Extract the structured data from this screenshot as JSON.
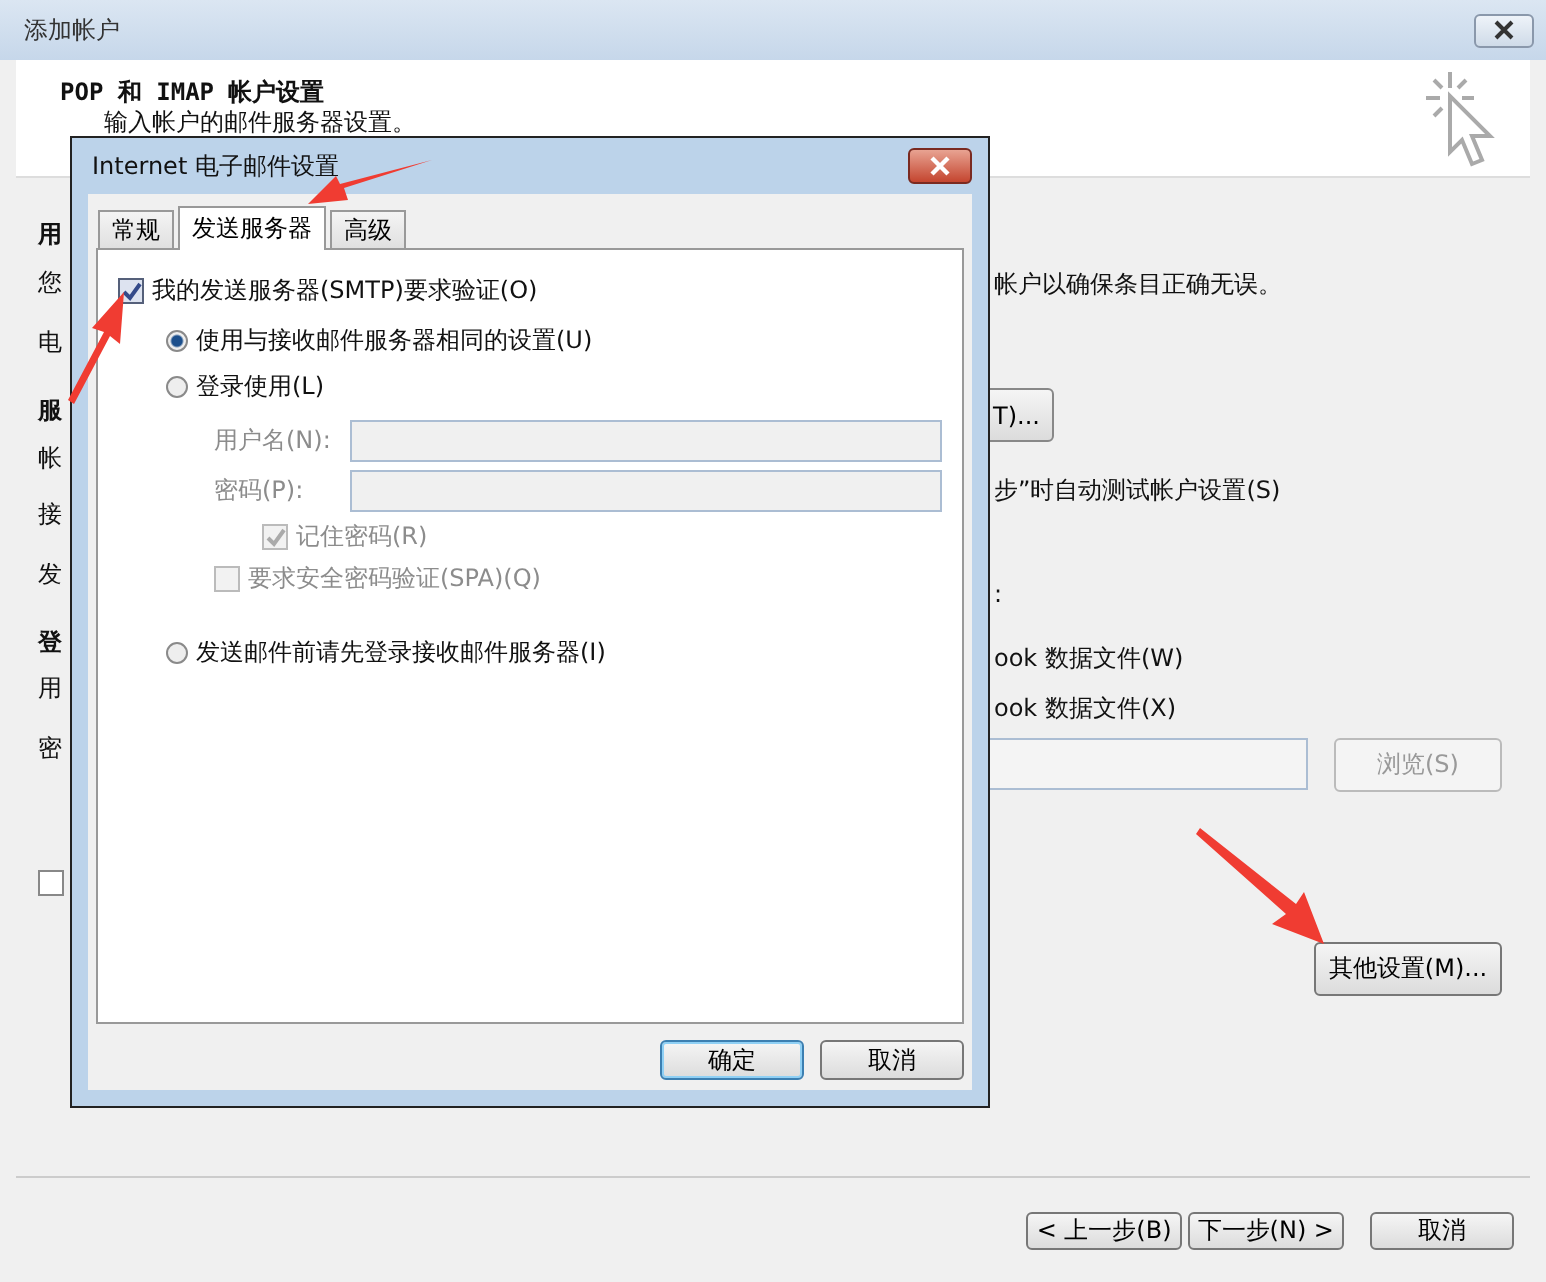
{
  "window": {
    "title": "添加帐户"
  },
  "header": {
    "title": "POP 和 IMAP 帐户设置",
    "subtitle": "输入帐户的邮件服务器设置。"
  },
  "left_fragments": [
    {
      "text": "用",
      "kind": "heading"
    },
    {
      "text": "您",
      "kind": "text"
    },
    {
      "text": "电",
      "kind": "text"
    },
    {
      "text": "服",
      "kind": "heading"
    },
    {
      "text": "帐",
      "kind": "text"
    },
    {
      "text": "接",
      "kind": "text"
    },
    {
      "text": "发",
      "kind": "text"
    },
    {
      "text": "登",
      "kind": "heading"
    },
    {
      "text": "用",
      "kind": "text"
    },
    {
      "text": "密",
      "kind": "text"
    }
  ],
  "left_checkbox": {
    "checked": false
  },
  "right_fragments": [
    {
      "text": "帐户以确保条目正确无误。",
      "kind": "text"
    },
    {
      "text": "T)...",
      "kind": "button"
    },
    {
      "text": "步”时自动测试帐户设置(S)",
      "kind": "text"
    },
    {
      "text": ":",
      "kind": "text"
    },
    {
      "text": "ook 数据文件(W)",
      "kind": "text"
    },
    {
      "text": "ook 数据文件(X)",
      "kind": "text"
    }
  ],
  "browse": {
    "label": "浏览(S)",
    "disabled": true
  },
  "more_settings": "其他设置(M)...",
  "footer_buttons": [
    {
      "label": "< 上一步(B)"
    },
    {
      "label": "下一步(N) >"
    },
    {
      "label": "取消"
    }
  ],
  "dialog": {
    "title": "Internet 电子邮件设置",
    "tabs": [
      {
        "label": "常规",
        "selected": false
      },
      {
        "label": "发送服务器",
        "selected": true
      },
      {
        "label": "高级",
        "selected": false
      }
    ],
    "options": [
      {
        "kind": "checkbox",
        "label": "我的发送服务器(SMTP)要求验证(O)",
        "checked": true,
        "disabled": false
      },
      {
        "kind": "radio",
        "label": "使用与接收邮件服务器相同的设置(U)",
        "selected": true,
        "disabled": false
      },
      {
        "kind": "radio",
        "label": "登录使用(L)",
        "selected": false,
        "disabled": false
      },
      {
        "kind": "field",
        "label": "用户名(N):",
        "disabled": true
      },
      {
        "kind": "field",
        "label": "密码(P):",
        "disabled": true
      },
      {
        "kind": "checkbox",
        "label": "记住密码(R)",
        "checked": true,
        "disabled": true
      },
      {
        "kind": "checkbox",
        "label": "要求安全密码验证(SPA)(Q)",
        "checked": false,
        "disabled": true
      },
      {
        "kind": "radio",
        "label": "发送邮件前请先登录接收邮件服务器(I)",
        "selected": false,
        "disabled": false
      }
    ],
    "buttons": [
      {
        "label": "确定",
        "default": true
      },
      {
        "label": "取消",
        "default": false
      }
    ]
  }
}
